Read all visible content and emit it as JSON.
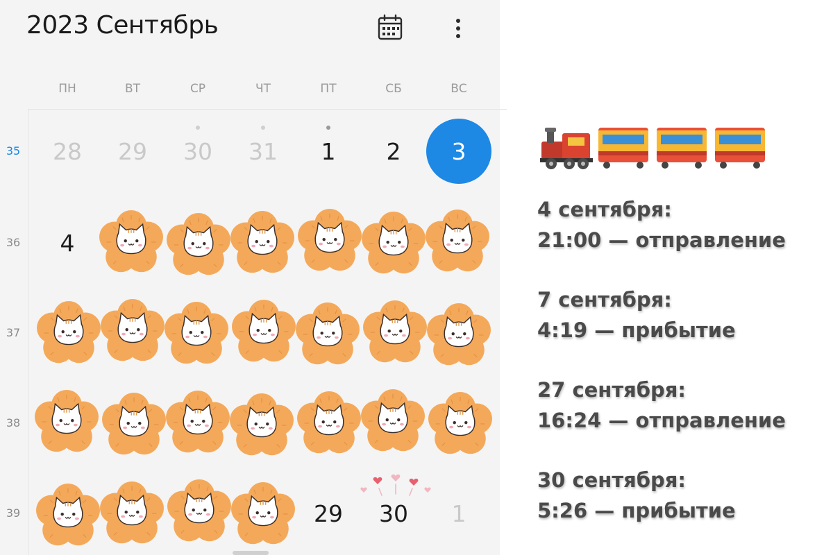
{
  "header": {
    "title": "2023 Сентябрь",
    "calendar_icon": "calendar-icon",
    "more_icon": "more-vertical-icon"
  },
  "weekdays": [
    "ПН",
    "ВТ",
    "СР",
    "ЧТ",
    "ПТ",
    "СБ",
    "ВС"
  ],
  "weeks": [
    {
      "number": "35",
      "current": true,
      "days": [
        {
          "label": "28",
          "dim": true
        },
        {
          "label": "29",
          "dim": true
        },
        {
          "label": "30",
          "dim": true,
          "dot": "light"
        },
        {
          "label": "31",
          "dim": true,
          "dot": "light"
        },
        {
          "label": "1",
          "dot": "dark"
        },
        {
          "label": "2"
        },
        {
          "label": "3",
          "today": true
        }
      ]
    },
    {
      "number": "36",
      "days": [
        {
          "label": "4"
        },
        {
          "sticker": true
        },
        {
          "sticker": true
        },
        {
          "sticker": true
        },
        {
          "sticker": true
        },
        {
          "sticker": true
        },
        {
          "sticker": true
        }
      ]
    },
    {
      "number": "37",
      "days": [
        {
          "sticker": true
        },
        {
          "sticker": true
        },
        {
          "sticker": true
        },
        {
          "sticker": true
        },
        {
          "sticker": true
        },
        {
          "sticker": true
        },
        {
          "sticker": true
        }
      ]
    },
    {
      "number": "38",
      "days": [
        {
          "sticker": true
        },
        {
          "sticker": true
        },
        {
          "sticker": true
        },
        {
          "sticker": true
        },
        {
          "sticker": true
        },
        {
          "sticker": true
        },
        {
          "sticker": true
        }
      ]
    },
    {
      "number": "39",
      "days": [
        {
          "sticker": true
        },
        {
          "sticker": true
        },
        {
          "sticker": true
        },
        {
          "sticker": true
        },
        {
          "label": "29"
        },
        {
          "label": "30",
          "hearts": true
        },
        {
          "label": "1",
          "dim": true
        }
      ]
    }
  ],
  "sticker_icon": "orange-flower-cat-sticker-icon",
  "hearts_icon": "hearts-decoration-icon",
  "train_icon": "train-emoji-icon",
  "schedule": [
    {
      "date": "4 сентября:",
      "event": "21:00 — отправление"
    },
    {
      "date": "7 сентября:",
      "event": "4:19 — прибытие"
    },
    {
      "date": "27 сентября:",
      "event": "16:24 — отправление"
    },
    {
      "date": "30 сентября:",
      "event": "5:26 — прибытие"
    }
  ],
  "colors": {
    "accent": "#1e88e5",
    "sticker_orange": "#f4a95a",
    "panel_bg": "#f4f4f4",
    "text": "#4a4a4a"
  }
}
